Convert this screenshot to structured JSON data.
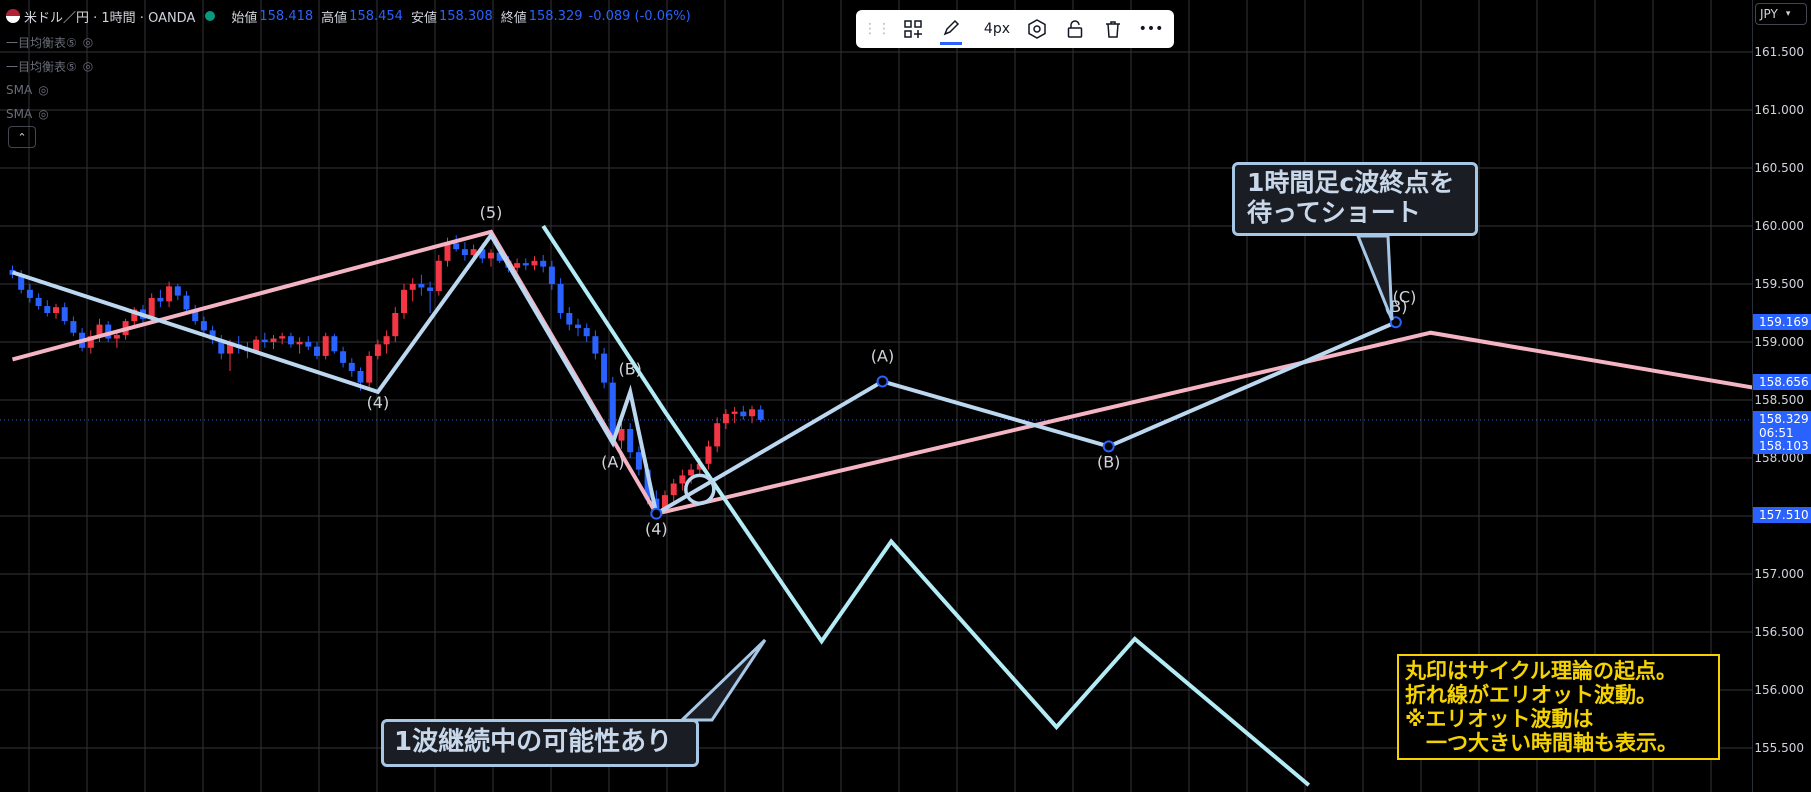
{
  "header": {
    "symbol": "米ドル／円 · 1時間 · OANDA",
    "open_label": "始値",
    "open": "158.418",
    "high_label": "高値",
    "high": "158.454",
    "low_label": "安値",
    "low": "158.308",
    "close_label": "終値",
    "close": "158.329",
    "change": "-0.089 (-0.06%)"
  },
  "indicators": [
    "一目均衡表⑤",
    "一目均衡表⑤",
    "SMA",
    "SMA"
  ],
  "toolbar": {
    "thickness": "4px"
  },
  "currency": "JPY",
  "colors": {
    "bg": "#000000",
    "grid": "#333338",
    "bull": "#f23645",
    "bear": "#2962ff",
    "pink": "#f4b4c4",
    "blue": "#bcd7f0",
    "cyan": "#b4ecf6",
    "accent": "#2962ff",
    "note": "#f5d300"
  },
  "price_tags": [
    {
      "text": "159.169",
      "price": 159.169
    },
    {
      "text": "158.656",
      "price": 158.656
    },
    {
      "text": "158.329",
      "price": 158.329,
      "sub": "06:51"
    },
    {
      "text": "158.103",
      "price": 158.103
    },
    {
      "text": "157.510",
      "price": 157.51
    }
  ],
  "callouts": {
    "top_right": [
      "1時間足c波終点を",
      "待ってショート"
    ],
    "bottom": "1波継続中の可能性あり"
  },
  "note": "丸印はサイクル理論の起点。\n折れ線がエリオット波動。\n※エリオット波動は\n　一つ大きい時間軸も表示。",
  "chart_data": {
    "type": "line",
    "title": "",
    "ylim": [
      155.32,
      161.95
    ],
    "y_ticks": [
      155.5,
      156.0,
      156.5,
      157.0,
      157.5,
      158.0,
      158.5,
      159.0,
      159.5,
      160.0,
      160.5,
      161.0,
      161.5
    ],
    "y_tick_labels": [
      "155.500",
      "156.000",
      "156.500",
      "157.000",
      "157.500",
      "158.000",
      "158.500",
      "159.000",
      "159.500",
      "160.000",
      "160.500",
      "161.000",
      "161.500"
    ],
    "grid": true,
    "last_price": 158.329,
    "candles": [
      [
        159.62,
        159.66,
        159.55,
        159.58
      ],
      [
        159.58,
        159.62,
        159.42,
        159.45
      ],
      [
        159.45,
        159.5,
        159.34,
        159.38
      ],
      [
        159.38,
        159.42,
        159.28,
        159.31
      ],
      [
        159.31,
        159.36,
        159.22,
        159.25
      ],
      [
        159.25,
        159.33,
        159.2,
        159.3
      ],
      [
        159.3,
        159.34,
        159.15,
        159.18
      ],
      [
        159.18,
        159.22,
        159.05,
        159.08
      ],
      [
        159.08,
        159.12,
        158.92,
        158.95
      ],
      [
        158.95,
        159.1,
        158.9,
        159.05
      ],
      [
        159.05,
        159.2,
        159.0,
        159.15
      ],
      [
        159.15,
        159.18,
        159.0,
        159.03
      ],
      [
        159.03,
        159.1,
        158.95,
        159.06
      ],
      [
        159.06,
        159.2,
        159.02,
        159.18
      ],
      [
        159.18,
        159.3,
        159.12,
        159.28
      ],
      [
        159.28,
        159.32,
        159.15,
        159.2
      ],
      [
        159.2,
        159.42,
        159.18,
        159.38
      ],
      [
        159.38,
        159.45,
        159.3,
        159.35
      ],
      [
        159.35,
        159.52,
        159.3,
        159.48
      ],
      [
        159.48,
        159.5,
        159.36,
        159.4
      ],
      [
        159.4,
        159.44,
        159.25,
        159.28
      ],
      [
        159.28,
        159.32,
        159.15,
        159.18
      ],
      [
        159.18,
        159.22,
        159.05,
        159.1
      ],
      [
        159.1,
        159.14,
        158.98,
        159.02
      ],
      [
        159.02,
        159.06,
        158.85,
        158.9
      ],
      [
        158.9,
        159.02,
        158.75,
        158.98
      ],
      [
        158.98,
        159.05,
        158.9,
        158.95
      ],
      [
        158.95,
        159.0,
        158.86,
        158.92
      ],
      [
        158.92,
        159.05,
        158.9,
        159.02
      ],
      [
        159.02,
        159.08,
        158.95,
        159.0
      ],
      [
        159.0,
        159.06,
        158.94,
        159.03
      ],
      [
        159.03,
        159.08,
        158.98,
        159.05
      ],
      [
        159.05,
        159.08,
        158.95,
        158.98
      ],
      [
        158.98,
        159.04,
        158.9,
        159.0
      ],
      [
        159.0,
        159.05,
        158.93,
        158.96
      ],
      [
        158.96,
        159.0,
        158.85,
        158.88
      ],
      [
        158.88,
        159.08,
        158.85,
        159.05
      ],
      [
        159.05,
        159.07,
        158.9,
        158.92
      ],
      [
        158.92,
        158.96,
        158.78,
        158.82
      ],
      [
        158.82,
        158.86,
        158.7,
        158.75
      ],
      [
        158.75,
        158.78,
        158.58,
        158.65
      ],
      [
        158.65,
        158.92,
        158.6,
        158.88
      ],
      [
        158.88,
        159.02,
        158.85,
        158.98
      ],
      [
        158.98,
        159.1,
        158.9,
        159.05
      ],
      [
        159.05,
        159.3,
        159.0,
        159.25
      ],
      [
        159.25,
        159.5,
        159.2,
        159.45
      ],
      [
        159.45,
        159.55,
        159.35,
        159.5
      ],
      [
        159.5,
        159.58,
        159.4,
        159.47
      ],
      [
        159.47,
        159.52,
        159.25,
        159.44
      ],
      [
        159.44,
        159.75,
        159.4,
        159.7
      ],
      [
        159.7,
        159.9,
        159.65,
        159.85
      ],
      [
        159.85,
        159.92,
        159.78,
        159.8
      ],
      [
        159.8,
        159.86,
        159.7,
        159.75
      ],
      [
        159.75,
        159.84,
        159.7,
        159.8
      ],
      [
        159.8,
        159.85,
        159.68,
        159.72
      ],
      [
        159.72,
        159.8,
        159.65,
        159.77
      ],
      [
        159.77,
        159.8,
        159.68,
        159.7
      ],
      [
        159.7,
        159.74,
        159.6,
        159.64
      ],
      [
        159.64,
        159.72,
        159.6,
        159.68
      ],
      [
        159.68,
        159.72,
        159.62,
        159.66
      ],
      [
        159.66,
        159.74,
        159.62,
        159.7
      ],
      [
        159.7,
        159.75,
        159.6,
        159.65
      ],
      [
        159.65,
        159.7,
        159.45,
        159.5
      ],
      [
        159.5,
        159.55,
        159.2,
        159.25
      ],
      [
        159.25,
        159.3,
        159.1,
        159.15
      ],
      [
        159.15,
        159.2,
        159.05,
        159.12
      ],
      [
        159.12,
        159.16,
        159.0,
        159.05
      ],
      [
        159.05,
        159.1,
        158.85,
        158.9
      ],
      [
        158.9,
        158.95,
        158.6,
        158.65
      ],
      [
        158.65,
        158.7,
        158.1,
        158.15
      ],
      [
        158.15,
        158.3,
        158.08,
        158.25
      ],
      [
        158.25,
        158.3,
        158.0,
        158.05
      ],
      [
        158.05,
        158.1,
        157.85,
        157.9
      ],
      [
        157.9,
        157.95,
        157.6,
        157.65
      ],
      [
        157.65,
        157.72,
        157.51,
        157.55
      ],
      [
        157.55,
        157.72,
        157.52,
        157.68
      ],
      [
        157.68,
        157.82,
        157.62,
        157.78
      ],
      [
        157.78,
        157.9,
        157.72,
        157.85
      ],
      [
        157.85,
        157.95,
        157.78,
        157.9
      ],
      [
        157.9,
        158.0,
        157.84,
        157.95
      ],
      [
        157.95,
        158.15,
        157.9,
        158.1
      ],
      [
        158.1,
        158.35,
        158.05,
        158.3
      ],
      [
        158.3,
        158.42,
        158.25,
        158.38
      ],
      [
        158.38,
        158.44,
        158.3,
        158.4
      ],
      [
        158.4,
        158.45,
        158.33,
        158.36
      ],
      [
        158.36,
        158.45,
        158.3,
        158.42
      ],
      [
        158.418,
        158.454,
        158.308,
        158.329
      ]
    ],
    "overlays": [
      {
        "name": "pink",
        "color": "#f4b4c4",
        "points": [
          [
            0,
            158.85
          ],
          [
            55,
            159.95
          ],
          [
            74,
            157.52
          ],
          [
            163,
            159.08
          ],
          [
            210,
            158.48
          ]
        ]
      },
      {
        "name": "blue",
        "color": "#bcd7f0",
        "points": [
          [
            0,
            159.6
          ],
          [
            42,
            158.57
          ],
          [
            55,
            159.92
          ],
          [
            69,
            158.13
          ],
          [
            71,
            158.57
          ],
          [
            74,
            157.52
          ],
          [
            100,
            158.66
          ],
          [
            126,
            158.1
          ],
          [
            159,
            159.17
          ]
        ]
      },
      {
        "name": "cyan",
        "color": "#b4ecf6",
        "points": [
          [
            61,
            160.0
          ],
          [
            75,
            158.4
          ],
          [
            93,
            156.42
          ],
          [
            101,
            157.28
          ],
          [
            120,
            155.68
          ],
          [
            129,
            156.44
          ],
          [
            149,
            155.18
          ]
        ]
      }
    ],
    "annotations": [
      {
        "text": "(5)",
        "idx": 55,
        "price": 160.07
      },
      {
        "text": "(4)",
        "idx": 42,
        "price": 158.43
      },
      {
        "text": "(A)",
        "idx": 69,
        "price": 157.92
      },
      {
        "text": "(B)",
        "idx": 71,
        "price": 158.72
      },
      {
        "text": "(4)",
        "idx": 74,
        "price": 157.34
      },
      {
        "text": "(A)",
        "idx": 100,
        "price": 158.83
      },
      {
        "text": "(B)",
        "idx": 126,
        "price": 157.92
      },
      {
        "text": "(B)",
        "idx": 159,
        "price": 159.26
      },
      {
        "text": "(C)",
        "idx": 160,
        "price": 159.34
      }
    ],
    "markers": [
      [
        74,
        157.52
      ],
      [
        100,
        158.66
      ],
      [
        126,
        158.1
      ],
      [
        159,
        159.17
      ]
    ],
    "cycle_circle": [
      79,
      157.73
    ]
  }
}
